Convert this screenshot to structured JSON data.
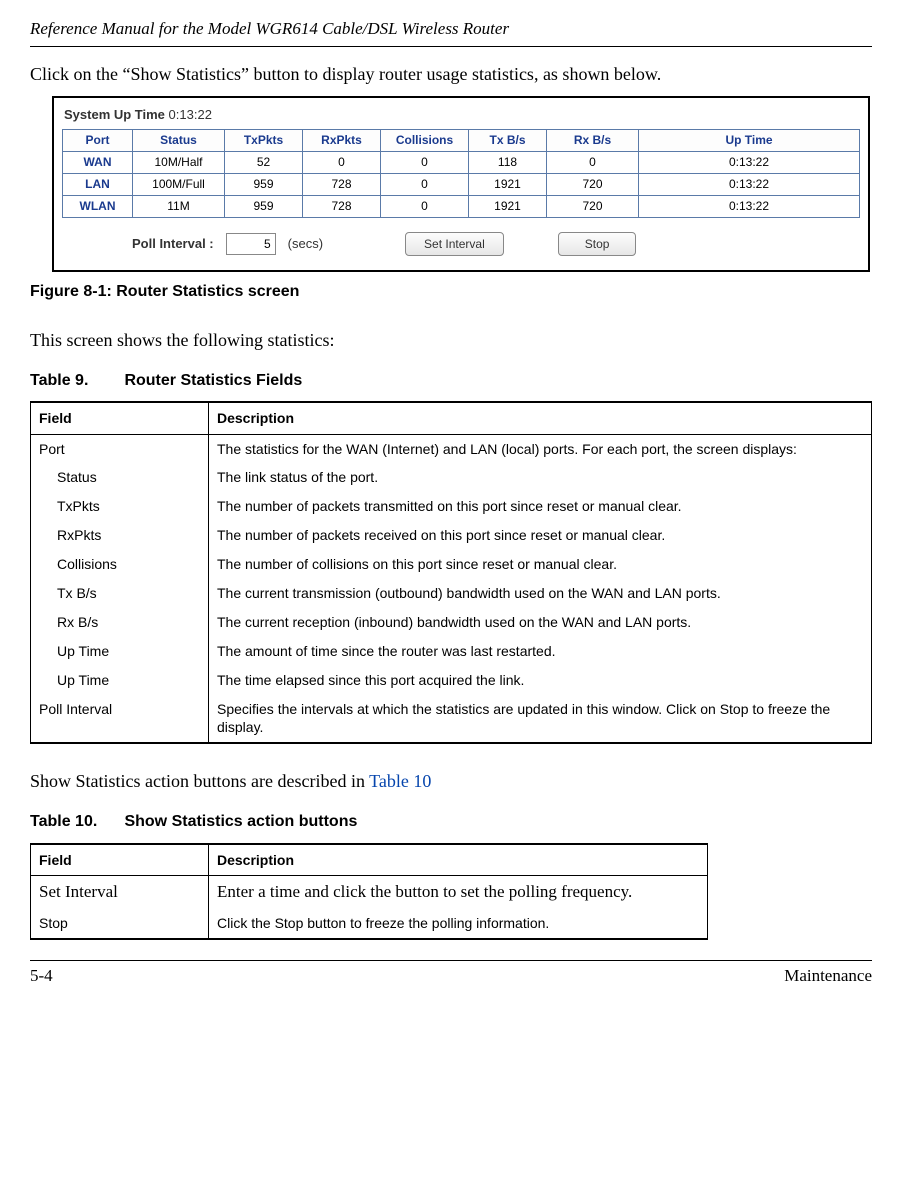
{
  "header_title": "Reference Manual for the Model WGR614 Cable/DSL Wireless Router",
  "intro_para": "Click on the “Show Statistics” button to display router usage statistics, as shown below.",
  "screenshot": {
    "uptime_label": "System Up Time",
    "uptime_value": "0:13:22",
    "headers": [
      "Port",
      "Status",
      "TxPkts",
      "RxPkts",
      "Collisions",
      "Tx B/s",
      "Rx B/s",
      "Up Time"
    ],
    "rows": [
      {
        "port": "WAN",
        "status": "10M/Half",
        "tx": "52",
        "rx": "0",
        "col": "0",
        "txb": "118",
        "rxb": "0",
        "up": "0:13:22"
      },
      {
        "port": "LAN",
        "status": "100M/Full",
        "tx": "959",
        "rx": "728",
        "col": "0",
        "txb": "1921",
        "rxb": "720",
        "up": "0:13:22"
      },
      {
        "port": "WLAN",
        "status": "11M",
        "tx": "959",
        "rx": "728",
        "col": "0",
        "txb": "1921",
        "rxb": "720",
        "up": "0:13:22"
      }
    ],
    "poll_label": "Poll Interval :",
    "poll_value": "5",
    "secs_label": "(secs)",
    "btn_set": "Set Interval",
    "btn_stop": "Stop"
  },
  "fig_caption": "Figure 8-1: Router Statistics screen",
  "para2": "This screen shows the following statistics:",
  "table9": {
    "num": "Table 9.",
    "title": "Router Statistics Fields",
    "h1": "Field",
    "h2": "Description",
    "rows": [
      {
        "f": "Port",
        "d": "The statistics for the WAN (Internet) and LAN (local) ports. For each port, the screen displays:",
        "sub": false
      },
      {
        "f": "Status",
        "d": "The link status of the port.",
        "sub": true
      },
      {
        "f": "TxPkts",
        "d": "The number of packets transmitted on this port since reset or manual clear.",
        "sub": true
      },
      {
        "f": "RxPkts",
        "d": "The number of packets received on this port since reset or manual clear.",
        "sub": true
      },
      {
        "f": "Collisions",
        "d": "The number of collisions on this port since reset or manual clear.",
        "sub": true
      },
      {
        "f": "Tx B/s",
        "d": "The current transmission (outbound) bandwidth used on the WAN and LAN ports.",
        "sub": true
      },
      {
        "f": "Rx B/s",
        "d": "The current reception (inbound) bandwidth used on the WAN and LAN ports.",
        "sub": true
      },
      {
        "f": "Up Time",
        "d": "The amount of time since the router was last restarted.",
        "sub": true
      },
      {
        "f": "Up Time",
        "d": "The time elapsed since this port acquired the link.",
        "sub": true
      },
      {
        "f": "Poll Interval",
        "d": "Specifies the intervals at which the statistics are updated in this window. Click on Stop to freeze the display.",
        "sub": false
      }
    ]
  },
  "para3_pre": "Show Statistics action buttons are described in ",
  "para3_link": "Table 10",
  "table10": {
    "num": "Table 10.",
    "title": "Show Statistics action buttons",
    "h1": "Field",
    "h2": "Description",
    "rows": [
      {
        "f": "Set Interval",
        "d": "Enter a time and click the button to set the polling frequency.",
        "serif": true
      },
      {
        "f": "Stop",
        "d": "Click the Stop button to freeze the polling information.",
        "serif": false
      }
    ]
  },
  "footer_left": "5-4",
  "footer_right": "Maintenance"
}
